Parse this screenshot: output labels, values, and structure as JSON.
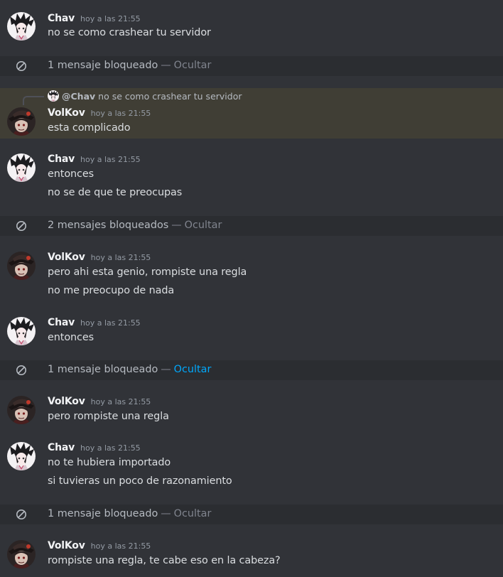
{
  "timestamp": "hoy a las 21:55",
  "users": {
    "chav": "Chav",
    "volkov": "VolKov"
  },
  "blocked": {
    "one": "1 mensaje bloqueado",
    "two": "2 mensajes bloqueados",
    "separator": "—",
    "hide": "Ocultar"
  },
  "reply": {
    "mention": "@Chav",
    "text": "no se como crashear tu servidor"
  },
  "messages": {
    "m1": {
      "lines": [
        "no se como crashear tu servidor"
      ]
    },
    "m2": {
      "lines": [
        "esta complicado"
      ]
    },
    "m3": {
      "lines": [
        "entonces",
        "no se de que te preocupas"
      ]
    },
    "m4": {
      "lines": [
        "pero ahi esta genio, rompiste una regla",
        "no me preocupo de nada"
      ]
    },
    "m5": {
      "lines": [
        "entonces"
      ]
    },
    "m6": {
      "lines": [
        "pero rompiste una regla"
      ]
    },
    "m7": {
      "lines": [
        "no te hubiera importado",
        "si tuvieras un poco de razonamiento"
      ]
    },
    "m8": {
      "lines": [
        "rompiste una regla, te cabe eso en la cabeza?"
      ]
    }
  },
  "icons": {
    "blocked": "blocked-circle-icon",
    "avatar_chav": "anime-avatar-icon",
    "avatar_volkov": "dark-hat-avatar-icon"
  },
  "colors": {
    "background": "#313338",
    "blocked_bg": "#2b2d31",
    "highlight": "#403e35",
    "link": "#00a8fc"
  }
}
